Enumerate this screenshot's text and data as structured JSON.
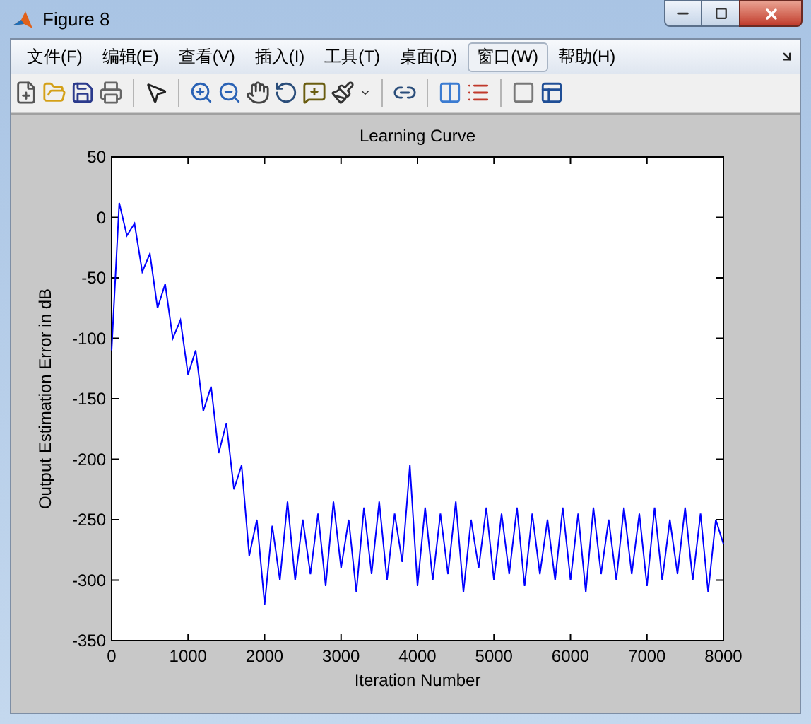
{
  "window": {
    "title": "Figure 8"
  },
  "menu": [
    {
      "label": "文件(F)",
      "selected": false
    },
    {
      "label": "编辑(E)",
      "selected": false
    },
    {
      "label": "查看(V)",
      "selected": false
    },
    {
      "label": "插入(I)",
      "selected": false
    },
    {
      "label": "工具(T)",
      "selected": false
    },
    {
      "label": "桌面(D)",
      "selected": false
    },
    {
      "label": "窗口(W)",
      "selected": true
    },
    {
      "label": "帮助(H)",
      "selected": false
    }
  ],
  "chart_data": {
    "type": "line",
    "title": "Learning Curve",
    "xlabel": "Iteration Number",
    "ylabel": "Output Estimation Error in dB",
    "x": [
      0,
      100,
      200,
      300,
      400,
      500,
      600,
      700,
      800,
      900,
      1000,
      1100,
      1200,
      1300,
      1400,
      1500,
      1600,
      1700,
      1800,
      1900,
      2000,
      2100,
      2200,
      2300,
      2400,
      2500,
      2600,
      2700,
      2800,
      2900,
      3000,
      3100,
      3200,
      3300,
      3400,
      3500,
      3600,
      3700,
      3800,
      3900,
      4000,
      4100,
      4200,
      4300,
      4400,
      4500,
      4600,
      4700,
      4800,
      4900,
      5000,
      5100,
      5200,
      5300,
      5400,
      5500,
      5600,
      5700,
      5800,
      5900,
      6000,
      6100,
      6200,
      6300,
      6400,
      6500,
      6600,
      6700,
      6800,
      6900,
      7000,
      7100,
      7200,
      7300,
      7400,
      7500,
      7600,
      7700,
      7800,
      7900,
      8000
    ],
    "series": [
      {
        "color": "#0000ff",
        "values": [
          -110,
          12,
          -15,
          -5,
          -45,
          -30,
          -75,
          -55,
          -100,
          -85,
          -130,
          -110,
          -160,
          -140,
          -195,
          -170,
          -225,
          -205,
          -280,
          -250,
          -320,
          -255,
          -300,
          -235,
          -300,
          -250,
          -295,
          -245,
          -305,
          -235,
          -290,
          -250,
          -310,
          -240,
          -295,
          -235,
          -300,
          -245,
          -285,
          -205,
          -305,
          -240,
          -300,
          -245,
          -295,
          -235,
          -310,
          -250,
          -290,
          -240,
          -300,
          -245,
          -295,
          -240,
          -305,
          -245,
          -295,
          -250,
          -300,
          -240,
          -300,
          -245,
          -310,
          -240,
          -295,
          -250,
          -300,
          -240,
          -295,
          -245,
          -305,
          -240,
          -300,
          -250,
          -295,
          -240,
          -300,
          -245,
          -310,
          -250,
          -270
        ]
      }
    ],
    "xlim": [
      0,
      8000
    ],
    "ylim": [
      -350,
      50
    ],
    "xticks": [
      0,
      1000,
      2000,
      3000,
      4000,
      5000,
      6000,
      7000,
      8000
    ],
    "yticks": [
      -350,
      -300,
      -250,
      -200,
      -150,
      -100,
      -50,
      0,
      50
    ]
  }
}
